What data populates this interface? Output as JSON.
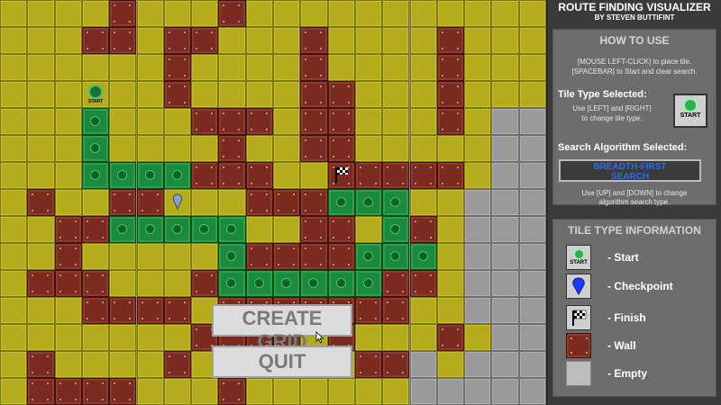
{
  "app": {
    "title": "ROUTE FINDING VISUALIZER",
    "author": "BY STEVEN BUTTIFINT"
  },
  "how_to_use": {
    "heading": "HOW TO USE",
    "line1": "[MOUSE LEFT-CLICK] to place tile.",
    "line2": "[SPACEBAR] to Start and clear search.",
    "tile_type_label": "Tile Type Selected:",
    "tile_hint1": "Use [LEFT] and [RIGHT]",
    "tile_hint2": "to change tile type.",
    "selected_tile": "START",
    "algo_label": "Search Algorithm Selected:",
    "algo_line1": "BREADTH-FIRST",
    "algo_line2": "SEARCH",
    "algo_hint1": "Use [UP] and [DOWN]  to change",
    "algo_hint2": "algorithm search type."
  },
  "tile_info": {
    "heading": "TILE TYPE INFORMATION",
    "items": [
      {
        "label": "- Start",
        "icon": "start-icon",
        "icon_text": "START"
      },
      {
        "label": "- Checkpoint",
        "icon": "checkpoint-icon"
      },
      {
        "label": "- Finish",
        "icon": "finish-flag-icon"
      },
      {
        "label": "- Wall",
        "icon": "wall-icon"
      },
      {
        "label": "- Empty",
        "icon": "empty-icon"
      }
    ]
  },
  "buttons": {
    "create_grid": "CREATE GRID",
    "quit": "QUIT"
  },
  "grid": {
    "cols": 20,
    "rows": 15,
    "legend": {
      "y": "visited",
      "e": "empty",
      "w": "wall",
      "p": "path"
    },
    "tiles": [
      "yyyywyyywyyyyyyyyyyy",
      "yyywwywwyyywyyyywyyy",
      "yyyyyywyyyywyyyywyyy",
      "yyyyyywyyyywwyyywyyy",
      "yyypyyywwwywwyyywyee",
      "yyypyyyywyywwyyyyyee",
      "yyyppppwwwyywwwwwyee",
      "ywyywwyyywwwpppyyeee",
      "yywwpppppyywwypwyeee",
      "yywyyyyypwwwwpppyeee",
      "ywwwyyywppppppwwyeee",
      "yyywwwwywwwwwwwyyeee",
      "yyyyyyywwwwywyyywyee",
      "ywyyyywyywyyywweyeee",
      "ywwwwyyywyyyyyyeeeee"
    ],
    "start_label": "START",
    "start_tile": [
      3,
      3
    ],
    "checkpoint_tile": [
      6,
      7
    ],
    "finish_tile": [
      12,
      6
    ]
  },
  "colors": {
    "visited": "#b5ac1d",
    "wall": "#7a2a1f",
    "path": "#1c8a3c",
    "empty": "#9a9a9a",
    "algo_text": "#2a6bff",
    "panel_bg": "#6d6d6d"
  }
}
